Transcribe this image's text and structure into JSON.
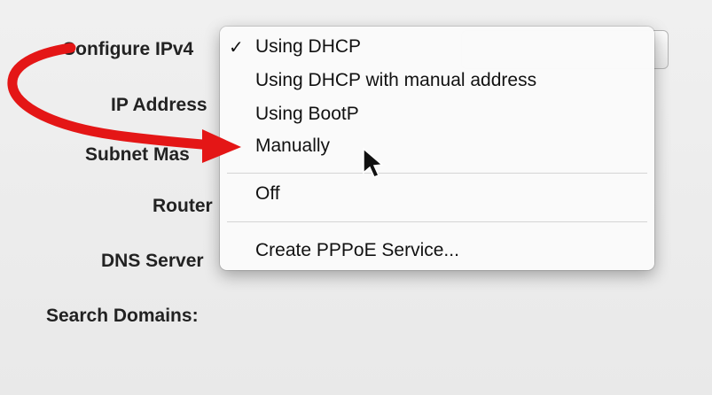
{
  "fields": {
    "configure_label": "Configure IPv4",
    "ip_label": "IP Address",
    "subnet_label": "Subnet Mas",
    "router_label": "Router",
    "dns_label": "DNS Server",
    "search_label": "Search Domains:"
  },
  "menu": {
    "checkmark": "✓",
    "items": [
      "Using DHCP",
      "Using DHCP with manual address",
      "Using BootP",
      "Manually",
      "Off",
      "Create PPPoE Service..."
    ],
    "selected": "Using DHCP",
    "hovered": "Manually"
  },
  "colors": {
    "arrow": "#e41616",
    "menu_bg": "#fafafa",
    "panel_bg": "#ececec"
  },
  "icons": {
    "annotation": "red-curved-arrow",
    "cursor": "mouse-pointer"
  }
}
